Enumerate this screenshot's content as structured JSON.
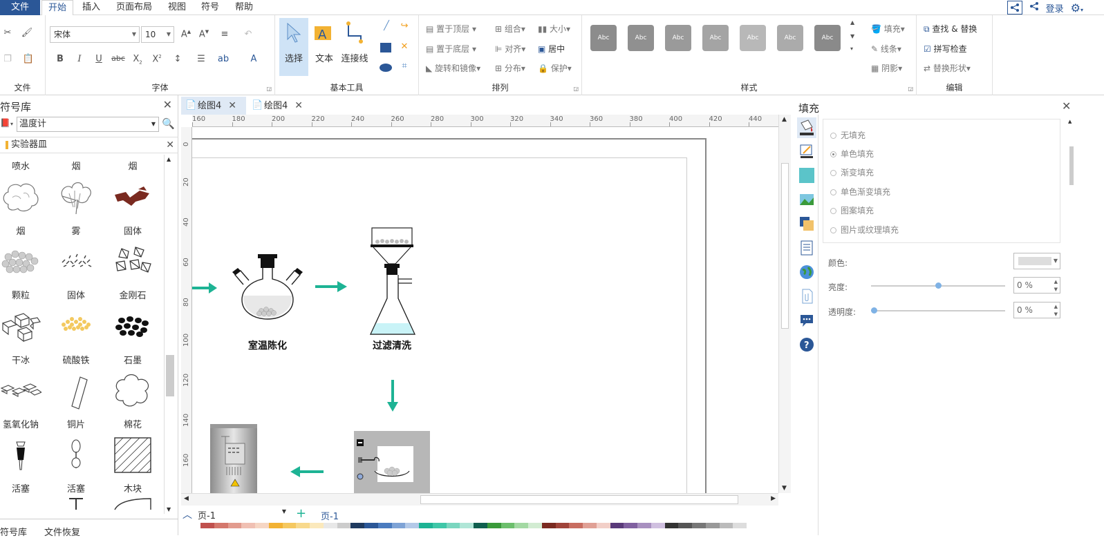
{
  "menu": {
    "file": "文件",
    "home": "开始",
    "insert": "插入",
    "layout": "页面布局",
    "view": "视图",
    "symbol": "符号",
    "help": "帮助",
    "login": "登录"
  },
  "ribbon": {
    "groups": {
      "file": "文件",
      "font": "字体",
      "basic_tools": "基本工具",
      "arrange": "排列",
      "style": "样式",
      "edit": "编辑"
    },
    "font_name": "宋体",
    "font_size": "10",
    "tools": {
      "select": "选择",
      "text": "文本",
      "connector": "连接线"
    },
    "arrange": {
      "bring_front": "置于顶层",
      "send_back": "置于底层",
      "rotate_mirror": "旋转和镜像",
      "group": "组合",
      "align": "对齐",
      "distribute": "分布",
      "size": "大小",
      "center": "居中",
      "protect": "保护"
    },
    "style_swatch_label": "Abc",
    "style_colors": [
      "#8c8c8c",
      "#909090",
      "#9a9a9a",
      "#a4a4a4",
      "#b8b8b8",
      "#ababab",
      "#8a8a8a"
    ],
    "format": {
      "fill": "填充",
      "line": "线条",
      "shadow": "阴影"
    },
    "edit": {
      "find_replace": "查找 & 替换",
      "spell_check": "拼写检查",
      "replace_shape": "替换形状"
    }
  },
  "library": {
    "title": "符号库",
    "search_value": "温度计",
    "category": "实验器皿",
    "items_top": [
      "喷水",
      "烟",
      "烟"
    ],
    "rows": [
      [
        "烟",
        "雾",
        "固体"
      ],
      [
        "颗粒",
        "固体",
        "金刚石"
      ],
      [
        "干冰",
        "硫酸铁",
        "石墨"
      ],
      [
        "氢氧化钠",
        "铜片",
        "棉花"
      ],
      [
        "活塞",
        "活塞",
        "木块"
      ]
    ],
    "tab_library": "符号库",
    "tab_recover": "文件恢复"
  },
  "documents": {
    "tabs": [
      "绘图4",
      "绘图4"
    ],
    "page_select": "页-1",
    "page_tab": "页-1",
    "page_add": "+"
  },
  "ruler": {
    "h": [
      "160",
      "180",
      "200",
      "220",
      "240",
      "260",
      "280",
      "300",
      "320",
      "340",
      "360",
      "380",
      "400",
      "420",
      "440"
    ],
    "v": [
      "0",
      "20",
      "40",
      "60",
      "80",
      "100",
      "120",
      "140",
      "160"
    ]
  },
  "canvas": {
    "label_aging": "室温陈化",
    "label_filter": "过滤清洗",
    "arrow_color": "#1db394"
  },
  "fill_panel": {
    "title": "填充",
    "options": [
      "无填充",
      "单色填充",
      "渐变填充",
      "单色渐变填充",
      "图案填充",
      "图片或纹理填充"
    ],
    "selected_option": "单色填充",
    "color_label": "颜色:",
    "brightness_label": "亮度:",
    "brightness_value": "0 %",
    "brightness_level": 0.5,
    "transparency_label": "透明度:",
    "transparency_value": "0 %",
    "transparency_level": 0.0
  }
}
